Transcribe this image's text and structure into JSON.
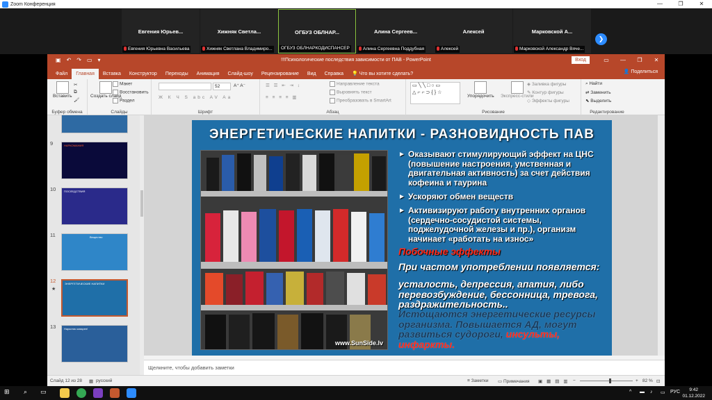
{
  "zoom": {
    "title": "Zoom Конференция",
    "participants": [
      {
        "name": "Евгения  Юрьев...",
        "label": "Евгения Юрьевна Васильева"
      },
      {
        "name": "Хижняк  Светла...",
        "label": "Хижняк Светлана Владимиро..."
      },
      {
        "name": "ОГБУЗ  ОБЛНАР...",
        "label": "ОГБУЗ ОБЛНАРКОДИСПАНСЕР"
      },
      {
        "name": "Алина  Сергеев...",
        "label": "Алина Сергеевна Поддубная"
      },
      {
        "name": "Алексей",
        "label": "Алексей"
      },
      {
        "name": "Марковской  А...",
        "label": "Марковской Александр Вяче..."
      }
    ]
  },
  "ppt": {
    "title": "!!!Психологические последствия зависимости от ПАВ  -  PowerPoint",
    "login": "Вход",
    "share": "Поделиться",
    "tabs": [
      "Файл",
      "Главная",
      "Вставка",
      "Конструктор",
      "Переходы",
      "Анимация",
      "Слайд-шоу",
      "Рецензирование",
      "Вид",
      "Справка",
      "Что вы хотите сделать?"
    ],
    "ribbon": {
      "paste": "Вставить",
      "clipboard": "Буфер обмена",
      "create_slide": "Создать слайд",
      "layout": "Макет",
      "restore": "Восстановить",
      "section": "Раздел",
      "slides": "Слайды",
      "font_size": "52",
      "font": "Шрифт",
      "text_direction": "Направление текста",
      "align_text": "Выровнять текст",
      "smartart": "Преобразовать в SmartArt",
      "paragraph": "Абзац",
      "arrange": "Упорядочить",
      "quick_styles": "Экспресс-стили",
      "fill": "Заливка фигуры",
      "outline": "Контур фигуры",
      "effects": "Эффекты фигуры",
      "drawing": "Рисование",
      "find": "Найти",
      "replace": "Заменить",
      "select": "Выделить",
      "editing": "Редактирование"
    },
    "thumbs": [
      {
        "num": "9",
        "title": "НАРКОМАНИЯ"
      },
      {
        "num": "10",
        "title": "ПОСЛЕДСТВИЯ"
      },
      {
        "num": "11",
        "title": "Вещество"
      },
      {
        "num": "12",
        "title": "ЭНЕРГЕТИЧЕСКИЕ НАПИТКИ",
        "star": "★"
      },
      {
        "num": "13",
        "title": "Наркотик коварен!"
      }
    ],
    "slide": {
      "title": "ЭНЕРГЕТИЧЕСКИЕ НАПИТКИ - РАЗНОВИДНОСТЬ ПАВ",
      "watermark": "www.SunSide.lv",
      "bullets": [
        "Оказывают стимулирующий эффект на ЦНС (повышение настроения, умственная и двигательная активность) за счет действия кофеина и таурина",
        "Ускоряют обмен веществ",
        "Активизируют работу внутренних органов (сердечно-сосудистой системы, поджелудочной железы и пр.), организм начинает «работать на износ»"
      ],
      "side_effects": "Побочные эффекты",
      "frequent": "При частом употреблении появляется:",
      "symptoms": "усталость, депрессия, апатия, либо перевозбуждение, бессонница, тревога, раздражительность..",
      "depleted": "Истощаются энергетические ресурсы организма. Повышается АД, могут развиться судороги, ",
      "strokes": "инсульты, инфаркты."
    },
    "notes_placeholder": "Щелкните, чтобы добавить заметки",
    "status": {
      "slide": "Слайд 12 из 28",
      "lang": "русский",
      "notes": "Заметки",
      "comments": "Примечания",
      "zoom": "82 %"
    }
  },
  "taskbar": {
    "lang": "РУС",
    "time": "9:42",
    "date": "01.12.2022"
  }
}
